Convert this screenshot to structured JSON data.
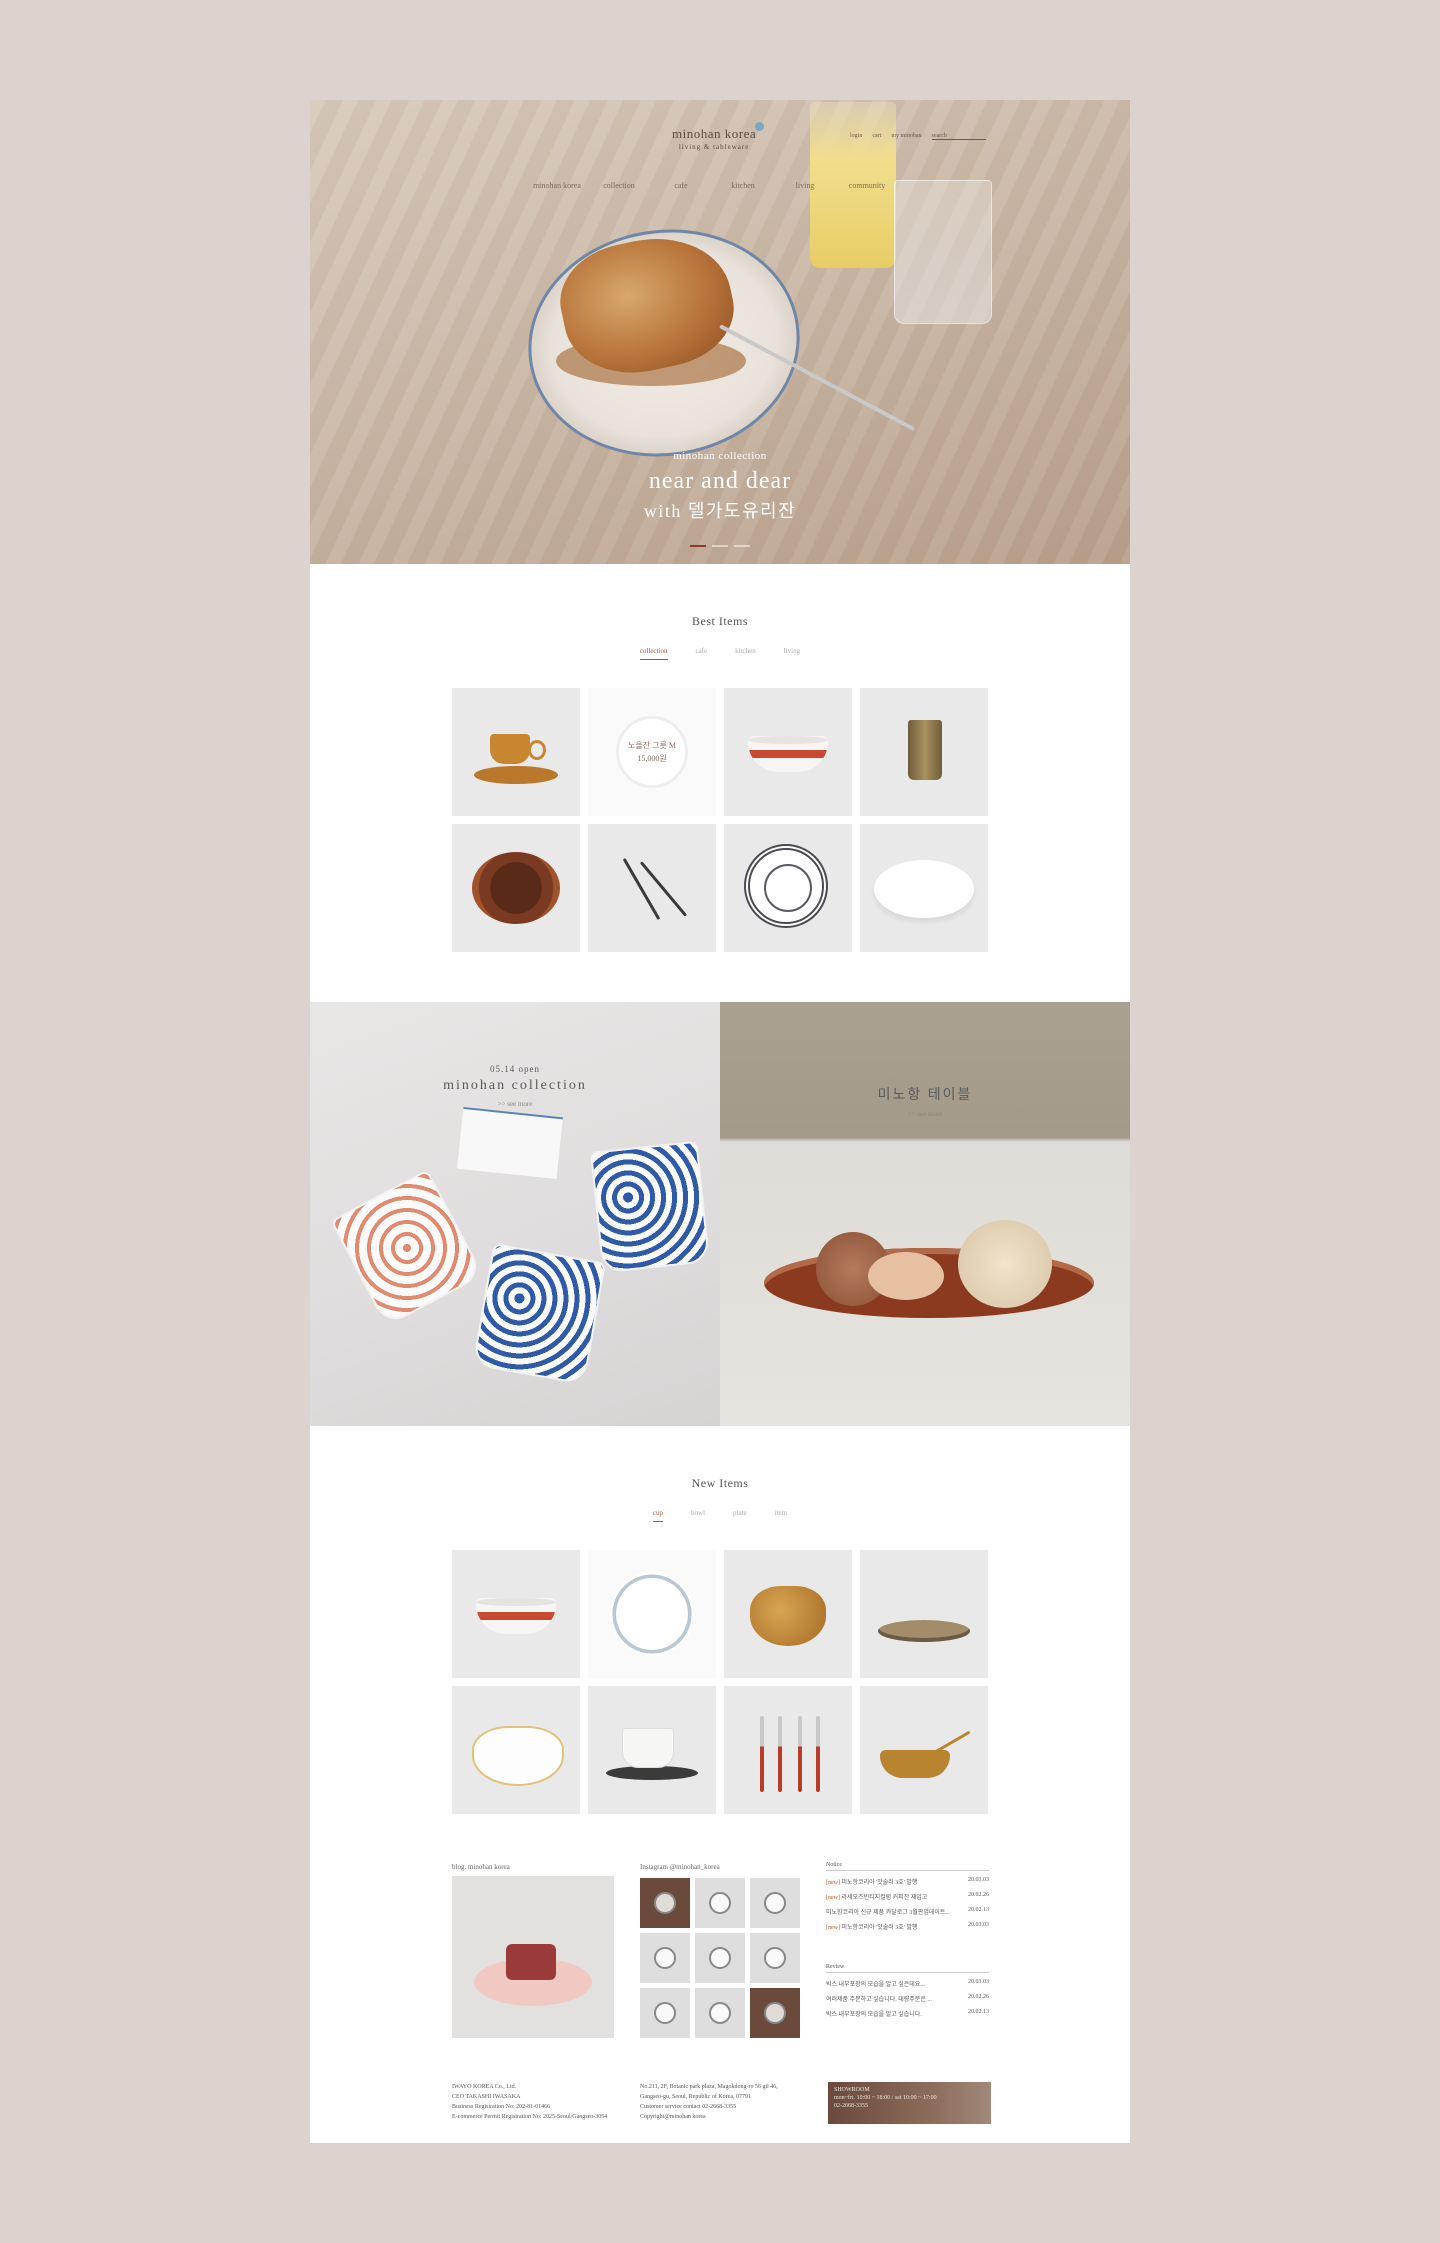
{
  "header": {
    "logo_main": "minohan korea",
    "logo_sub": "living & tableware",
    "util": [
      "login",
      "cart",
      "my minohan",
      "search"
    ],
    "gnb": [
      "minohan korea",
      "collection",
      "cafe",
      "kitchen",
      "living",
      "community"
    ]
  },
  "hero": {
    "subtitle": "minohan collection",
    "title": "near and dear",
    "title2": "with 델가도유리잔"
  },
  "best": {
    "title": "Best Items",
    "tabs": [
      "collection",
      "cafe",
      "kitchen",
      "living"
    ],
    "active_tab": "collection",
    "hover_name": "노을잔 그릇 M",
    "hover_price": "15,000원"
  },
  "banners": {
    "left_date": "05.14 open",
    "left_title": "minohan collection",
    "left_more": ">> see more",
    "right_title": "미노항 테이블",
    "right_more": ">> see more"
  },
  "new_items": {
    "title": "New Items",
    "tabs": [
      "cup",
      "bowl",
      "plate",
      "item"
    ],
    "active_tab": "cup"
  },
  "bottom": {
    "blog_title": "blog. minohan korea",
    "insta_title": "Instagram @minohan_korea",
    "notice_title": "Notice",
    "notices": [
      {
        "tag": "[new]",
        "text": "미노항코리아 '맛술러 3호' 발행",
        "date": "20.03.03"
      },
      {
        "tag": "[new]",
        "text": "라세오즈빈티지컬럼 커피잔 재입고",
        "date": "20.02.26"
      },
      {
        "tag": "",
        "text": "미노항코리아 신규 제품 카달로그 3월판업데이트...",
        "date": "20.02.13"
      },
      {
        "tag": "[new]",
        "text": "미노항코리아 '맛술러 3호' 발행",
        "date": "20.03.03"
      }
    ],
    "review_title": "Review",
    "reviews": [
      {
        "text": "박스 내부포장의 모습을 알고 싶은데요...",
        "date": "20.03.03"
      },
      {
        "text": "여러제품 주문하고 싶습니다. 대량주문은 ...",
        "date": "20.02.26"
      },
      {
        "text": "박스 내부포장의 모습을 알고 싶습니다.",
        "date": "20.02.13"
      }
    ]
  },
  "footer": {
    "company": [
      "IWAYO KOREA Co., Ltd.",
      "CEO TAKASHI IWASAKA",
      "Business Registration No: 202-81-01466",
      "E-commerce Permit Registration No: 2025-Seoul/Gangseo-3054"
    ],
    "address": [
      "No.211, 2F, Botanic park plaza, Magokdong-ro 56 gil 46,",
      "Gangseo-gu, Seoul, Republic of Korea, 07791",
      "Customer service contact 02-2668-3355",
      "Copyright@minohan korea"
    ],
    "showroom": [
      "SHOWROOM",
      "mon~fri. 10:00 ~ 18:00 / sat 10:00 ~ 17:00",
      "02-2668-3355"
    ]
  },
  "colors": {
    "background": "#dcd3ce",
    "accent": "#9b5a46",
    "notice_highlight": "#c0522d"
  }
}
